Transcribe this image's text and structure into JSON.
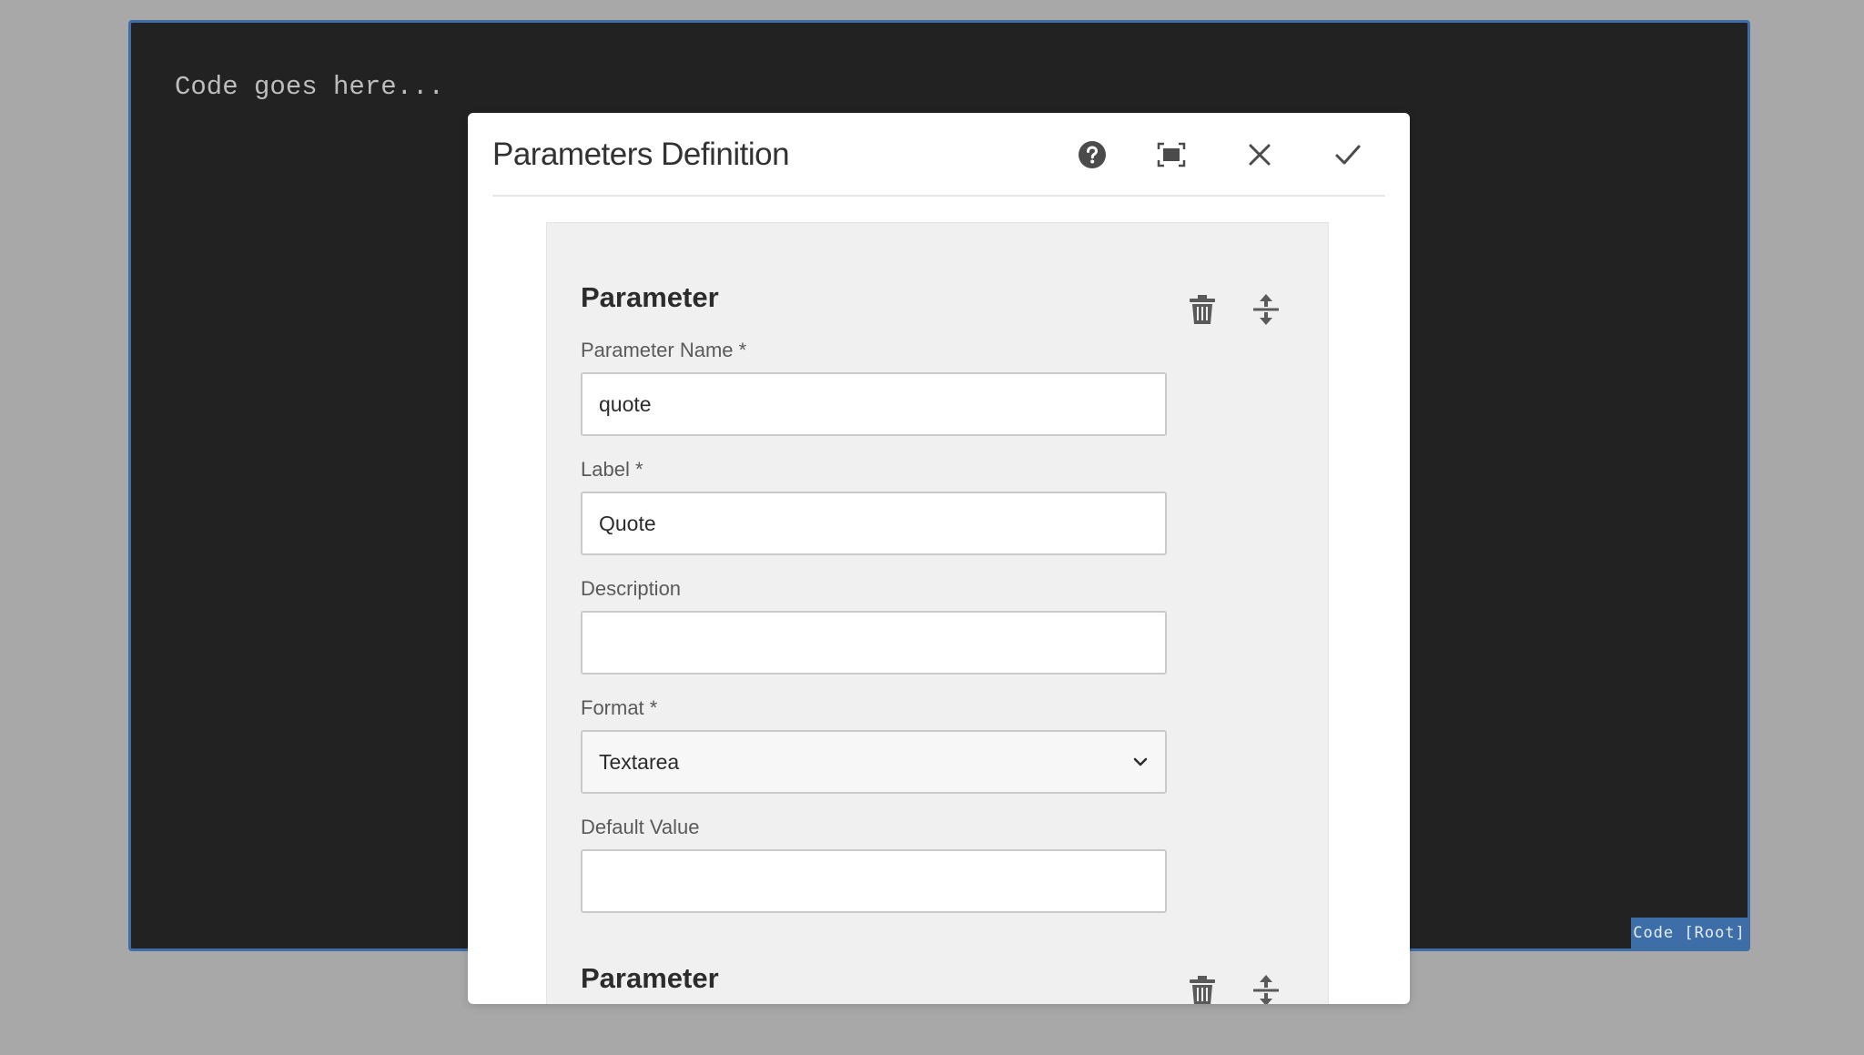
{
  "editor": {
    "placeholder": "Code goes here...",
    "tag": "Code [Root]"
  },
  "dialog": {
    "title": "Parameters Definition",
    "icons": {
      "help": "help-icon",
      "fullscreen": "fullscreen-icon",
      "close": "close-icon",
      "confirm": "checkmark-icon"
    },
    "parameters": [
      {
        "heading": "Parameter",
        "fields": {
          "name": {
            "label": "Parameter Name *",
            "value": "quote"
          },
          "label": {
            "label": "Label *",
            "value": "Quote"
          },
          "description": {
            "label": "Description",
            "value": ""
          },
          "format": {
            "label": "Format *",
            "value": "Textarea"
          },
          "default": {
            "label": "Default Value",
            "value": ""
          }
        }
      },
      {
        "heading": "Parameter"
      }
    ]
  },
  "colors": {
    "accent": "#3d6ea8",
    "editor_bg": "#222222",
    "panel_bg": "#f0f0f0"
  }
}
